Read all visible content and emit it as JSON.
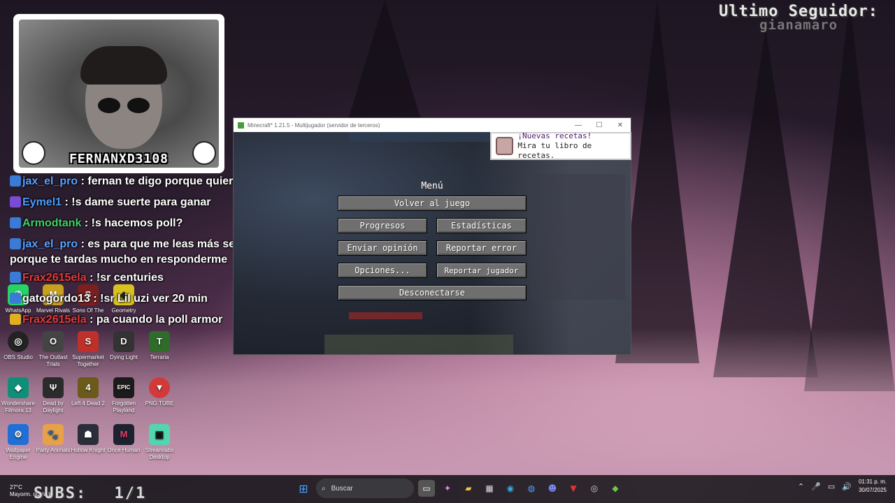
{
  "overlay": {
    "last_follower_title": "Ultimo Seguidor:",
    "last_follower_name": "gianamaro",
    "streamer_name": "FERNANXD3108",
    "subs_label": "SUBS:",
    "subs_value": "1/1"
  },
  "chat": [
    {
      "user": "jax_el_pro",
      "color": "#5aa0ff",
      "message": ": fernan te digo porque quiero el vip"
    },
    {
      "user": "Eymel1",
      "color": "#4a9cff",
      "message": ": !s dame suerte para ganar"
    },
    {
      "user": "Armodtank",
      "color": "#3fd06a",
      "message": ": !s hacemos poll?"
    },
    {
      "user": "jax_el_pro",
      "color": "#5aa0ff",
      "message": ": es para que me leas más seguido",
      "continuation": "porque te tardas mucho en responderme"
    },
    {
      "user": "Frax2615ela",
      "color": "#e23a3a",
      "message": ": !sr centuries"
    },
    {
      "user": "gatogordo13",
      "color": "#ffffff",
      "message": ": !sr Lil uzi ver 20 min"
    },
    {
      "user": "Frax2615ela",
      "color": "#e23a3a",
      "message": ": pa cuando la poll armor"
    }
  ],
  "desktop_icons": [
    {
      "label": "WhatsApp",
      "icon": "whatsapp-icon",
      "color": "#25d366"
    },
    {
      "label": "Marvel Rivals",
      "icon": "marvel-rivals-icon",
      "color": "#c8a020"
    },
    {
      "label": "Sons Of The",
      "icon": "sons-of-the-forest-icon",
      "color": "#7a2020"
    },
    {
      "label": "Geometry",
      "icon": "geometry-dash-icon",
      "color": "#d7c21f"
    },
    {
      "label": "OBS Studio",
      "icon": "obs-icon",
      "color": "#222222"
    },
    {
      "label": "The Outlast Trials",
      "icon": "outlast-icon",
      "color": "#444444"
    },
    {
      "label": "Supermarket Together",
      "icon": "supermarket-icon",
      "color": "#c0302a"
    },
    {
      "label": "Dying Light",
      "icon": "dying-light-icon",
      "color": "#333333"
    },
    {
      "label": "Terraria",
      "icon": "terraria-icon",
      "color": "#2f6b2a"
    },
    {
      "label": "Wondershare Filmora 13",
      "icon": "filmora-icon",
      "color": "#0e8f7a"
    },
    {
      "label": "Dead by Daylight",
      "icon": "dbd-icon",
      "color": "#2b2b2b"
    },
    {
      "label": "Left 4 Dead 2",
      "icon": "l4d2-icon",
      "color": "#6b5a1a"
    },
    {
      "label": "Forgotten Playland",
      "icon": "epic-icon",
      "color": "#1b1b1b"
    },
    {
      "label": "PNG TUBE",
      "icon": "pngtube-icon",
      "color": "#d23a3a"
    },
    {
      "label": "Wallpaper Engine",
      "icon": "wallpaper-engine-icon",
      "color": "#1f6fd6"
    },
    {
      "label": "Party Animals",
      "icon": "party-animals-icon",
      "color": "#e6a14a"
    },
    {
      "label": "Hollow Knight",
      "icon": "hollow-knight-icon",
      "color": "#2a2d3a"
    },
    {
      "label": "Once Human",
      "icon": "once-human-icon",
      "color": "#1c2230"
    },
    {
      "label": "Streamlabs Desktop",
      "icon": "streamlabs-icon",
      "color": "#53d6b0"
    }
  ],
  "minecraft": {
    "window_title": "Minecraft* 1.21.5 - Multijugador (servidor de terceros)",
    "menu_title": "Menú",
    "buttons": {
      "back_to_game": "Volver al juego",
      "advancements": "Progresos",
      "statistics": "Estadísticas",
      "feedback": "Enviar opinión",
      "report_bug": "Reportar error",
      "options": "Opciones...",
      "report_player": "Reportar jugador",
      "disconnect": "Desconectarse"
    },
    "toast": {
      "title": "¡Nuevas recetas!",
      "subtitle": "Mira tu libro de recetas."
    }
  },
  "taskbar": {
    "search_placeholder": "Buscar",
    "time": "01:31 p. m.",
    "date": "30/07/2025",
    "weather_temp": "27°C",
    "weather_text": "Mayorm. nublado"
  },
  "colors": {
    "mc_button": "#6f6f6f",
    "toast_title": "#4b1a6b",
    "taskbar": "#201c22"
  }
}
